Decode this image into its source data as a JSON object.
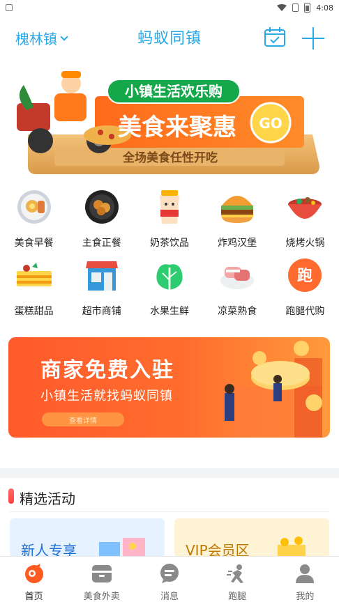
{
  "status_bar": {
    "time": "4:08"
  },
  "header": {
    "town": "槐林镇",
    "brand": "蚂蚁同镇",
    "calendar_icon": "calendar-check-icon",
    "plus_icon": "plus-icon",
    "accent": "#2aa9e7"
  },
  "banner": {
    "line1": "小镇生活欢乐购",
    "line2": "美食来聚惠",
    "go": "GO",
    "line3": "全场美食任性开吃"
  },
  "categories": [
    {
      "label": "美食早餐",
      "icon": "breakfast-icon"
    },
    {
      "label": "主食正餐",
      "icon": "main-meal-icon"
    },
    {
      "label": "奶茶饮品",
      "icon": "milk-tea-icon"
    },
    {
      "label": "炸鸡汉堡",
      "icon": "burger-icon"
    },
    {
      "label": "烧烤火锅",
      "icon": "hotpot-icon"
    },
    {
      "label": "蛋糕甜品",
      "icon": "cake-icon"
    },
    {
      "label": "超市商铺",
      "icon": "store-icon"
    },
    {
      "label": "水果生鲜",
      "icon": "vegetable-icon"
    },
    {
      "label": "凉菜熟食",
      "icon": "cold-dish-icon"
    },
    {
      "label": "跑腿代购",
      "icon": "errand-icon"
    }
  ],
  "errand_glyph": "跑",
  "promo": {
    "title": "商家免费入驻",
    "subtitle": "小镇生活就找蚂蚁同镇",
    "button": "查看详情"
  },
  "section": {
    "title": "精选活动",
    "cards": [
      {
        "label": "新人专享"
      },
      {
        "label": "VIP会员区"
      }
    ]
  },
  "tabs": [
    {
      "label": "首页",
      "icon": "home-icon",
      "active": true
    },
    {
      "label": "美食外卖",
      "icon": "food-delivery-icon",
      "active": false
    },
    {
      "label": "消息",
      "icon": "message-icon",
      "active": false
    },
    {
      "label": "跑腿",
      "icon": "errand-runner-icon",
      "active": false
    },
    {
      "label": "我的",
      "icon": "profile-icon",
      "active": false
    }
  ]
}
